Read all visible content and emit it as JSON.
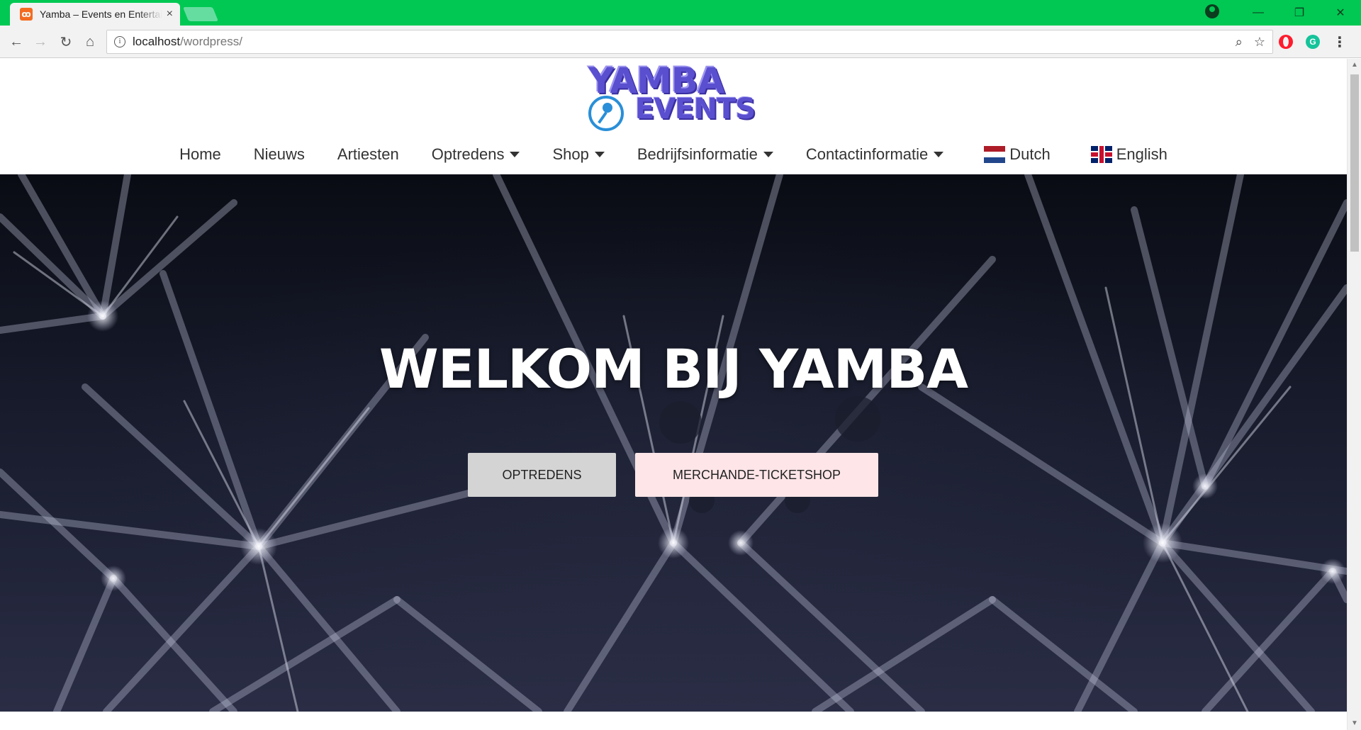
{
  "browser": {
    "tab_title": "Yamba – Events en Entertainment",
    "tab_close": "×",
    "url_host": "localhost",
    "url_path": "/wordpress/",
    "buttons": {
      "back": "←",
      "forward": "→",
      "reload": "↻",
      "home": "⌂",
      "zoom": "⌕",
      "bookmark": "☆",
      "menu": "⋮",
      "minimize": "—",
      "restore": "❐",
      "close": "✕"
    }
  },
  "site": {
    "logo_line1": "YAMBA",
    "logo_line2": "EVENTS",
    "nav": {
      "home": "Home",
      "nieuws": "Nieuws",
      "artiesten": "Artiesten",
      "optredens": "Optredens",
      "shop": "Shop",
      "bedrijfsinformatie": "Bedrijfsinformatie",
      "contactinformatie": "Contactinformatie",
      "dutch": "Dutch",
      "english": "English"
    },
    "hero": {
      "title": "WELKOM BIJ YAMBA",
      "button_optredens": "OPTREDENS",
      "button_shop": "MERCHANDE-TICKETSHOP"
    }
  },
  "icons": {
    "favicon": "xampp-icon",
    "profile": "profile-icon",
    "extension1": "opera-vpn-icon",
    "extension2": "grammarly-icon"
  },
  "colors": {
    "titlebar": "#00c853",
    "logo": "#5a4fcf",
    "btn_optredens": "#d4d4d4",
    "btn_shop": "#fde5e8"
  }
}
